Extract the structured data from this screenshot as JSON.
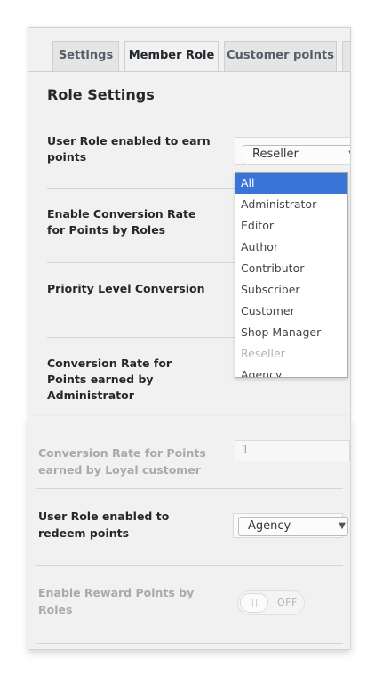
{
  "tabs": [
    {
      "label": "Settings"
    },
    {
      "label": "Member Role"
    },
    {
      "label": "Customer points"
    }
  ],
  "heading": "Role Settings",
  "rows": {
    "earn_role": {
      "label": "User Role enabled to earn points",
      "selected": "Reseller"
    },
    "conversion_by_role": {
      "label": "Enable Conversion Rate for Points by Roles"
    },
    "priority": {
      "label": "Priority Level Conversion"
    },
    "admin_rate": {
      "label": "Conversion Rate for Points earned by Administrator"
    }
  },
  "dropdown": {
    "options": [
      {
        "label": "All",
        "state": "selected"
      },
      {
        "label": "Administrator",
        "state": "normal"
      },
      {
        "label": "Editor",
        "state": "normal"
      },
      {
        "label": "Author",
        "state": "normal"
      },
      {
        "label": "Contributor",
        "state": "normal"
      },
      {
        "label": "Subscriber",
        "state": "normal"
      },
      {
        "label": "Customer",
        "state": "normal"
      },
      {
        "label": "Shop Manager",
        "state": "normal"
      },
      {
        "label": "Reseller",
        "state": "disabled"
      },
      {
        "label": "Agency",
        "state": "normal"
      }
    ]
  },
  "bottom": {
    "loyal_rate": {
      "label": "Conversion Rate for Points earned by Loyal customer",
      "value": "1"
    },
    "redeem_role": {
      "label": "User Role enabled to redeem points",
      "selected": "Agency"
    },
    "reward_by_roles": {
      "label": "Enable Reward Points by Roles",
      "toggle": "OFF"
    }
  },
  "colors": {
    "accent": "#3875d7",
    "panel_bg": "#f1f1f1",
    "disabled_text": "#a7aaad"
  },
  "icons": {
    "select_arrow": "chevron-down-icon"
  }
}
